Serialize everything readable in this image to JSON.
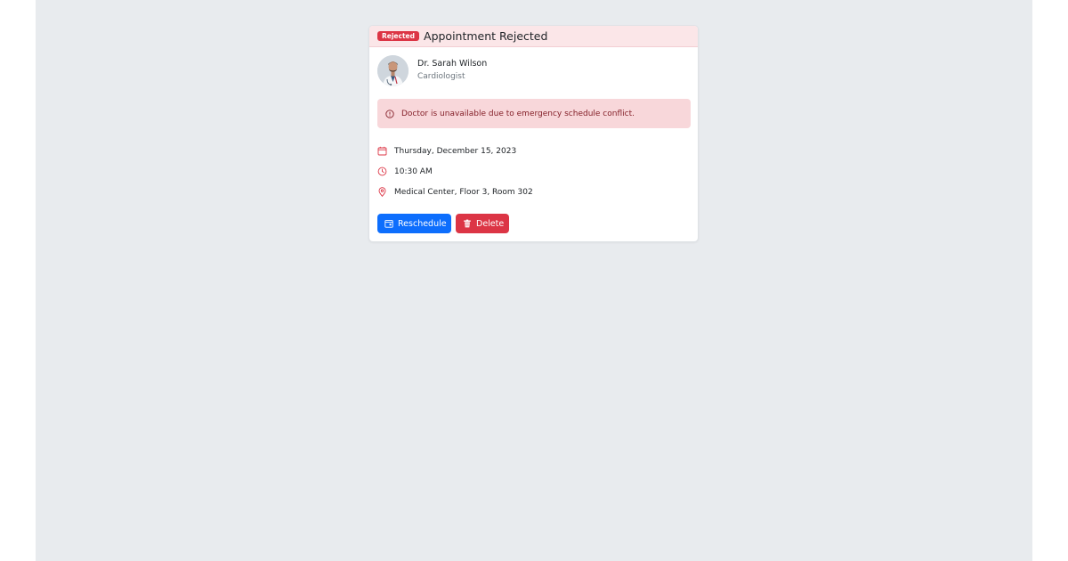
{
  "appointment": {
    "status_badge": "Rejected",
    "title": "Appointment Rejected",
    "doctor": {
      "name": "Dr. Sarah Wilson",
      "specialty": "Cardiologist",
      "avatar_icon": "doctor-portrait"
    },
    "rejection_reason": "Doctor is unavailable due to emergency schedule conflict.",
    "details": {
      "date": "Thursday, December 15, 2023",
      "time": "10:30 AM",
      "location": "Medical Center, Floor 3, Room 302"
    },
    "actions": {
      "reschedule_label": "Reschedule",
      "delete_label": "Delete"
    }
  },
  "icons": {
    "alert": "exclamation-circle-icon",
    "date": "calendar-icon",
    "time": "clock-icon",
    "location": "map-pin-icon",
    "reschedule": "calendar-event-icon",
    "delete": "trash-icon"
  },
  "colors": {
    "page_background": "#e8ebee",
    "header_background": "#fbe6e8",
    "danger": "#dc3545",
    "primary": "#0d6efd",
    "alert_background": "#f8d7da",
    "alert_text": "#842029"
  }
}
